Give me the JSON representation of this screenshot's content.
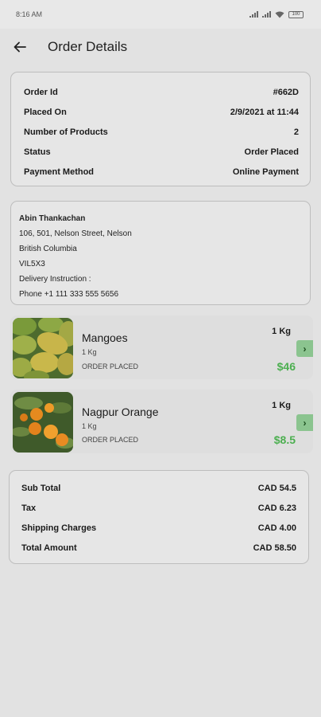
{
  "status_bar": {
    "time": "8:16 AM",
    "battery": "100"
  },
  "header": {
    "title": "Order Details"
  },
  "order_info": [
    {
      "label": "Order Id",
      "value": "#662D"
    },
    {
      "label": "Placed On",
      "value": "2/9/2021 at 11:44"
    },
    {
      "label": "Number of Products",
      "value": "2"
    },
    {
      "label": "Status",
      "value": "Order Placed"
    },
    {
      "label": "Payment Method",
      "value": "Online Payment"
    }
  ],
  "address": {
    "name": "Abin Thankachan",
    "street": "106, 501, Nelson Street, Nelson",
    "province": "British Columbia",
    "postal": "VIL5X3",
    "instruction": "Delivery Instruction :",
    "phone": "Phone +1 111 333 555 5656"
  },
  "products": [
    {
      "name": "Mangoes",
      "quantity": "1 Kg",
      "status": "ORDER PLACED",
      "unit": "1 Kg",
      "price": "$46",
      "image": "mango-photo"
    },
    {
      "name": "Nagpur Orange",
      "quantity": "1 Kg",
      "status": "ORDER PLACED",
      "unit": "1 Kg",
      "price": "$8.5",
      "image": "orange-photo"
    }
  ],
  "summary": [
    {
      "label": "Sub Total",
      "value": "CAD 54.5"
    },
    {
      "label": "Tax",
      "value": "CAD 6.23"
    },
    {
      "label": "Shipping Charges",
      "value": "CAD 4.00"
    },
    {
      "label": "Total Amount",
      "value": "CAD 58.50"
    }
  ],
  "colors": {
    "background": "#e2e2e2",
    "price_green": "#4caf50",
    "arrow_green": "#8bc48f"
  }
}
